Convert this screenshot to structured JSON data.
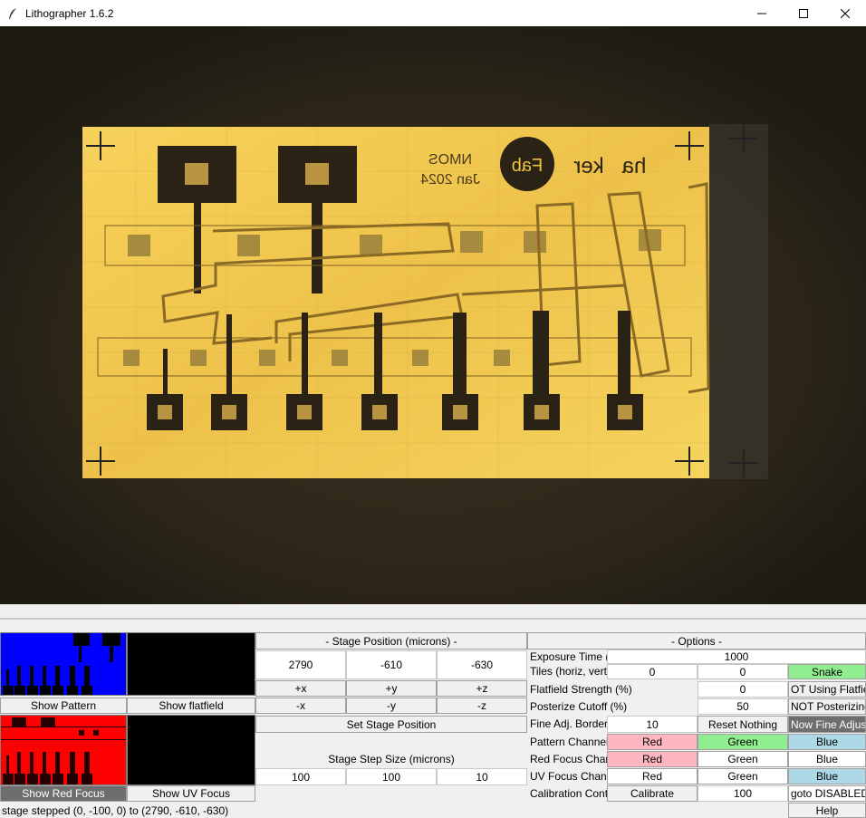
{
  "window": {
    "title": "Lithographer 1.6.2",
    "minimize_glyph": "—",
    "maximize_glyph": "☐",
    "close_glyph": "✕"
  },
  "camera": {
    "chip_text_top": "NMOS",
    "chip_text_date": "Jan 2024",
    "logo_text_left": "ha",
    "logo_text_mid": "ker",
    "logo_text_circle": "Fab"
  },
  "preview": {
    "show_pattern": "Show Pattern",
    "show_flatfield": "Show flatfield",
    "show_red_focus": "Show Red Focus",
    "show_uv_focus": "Show UV Focus"
  },
  "stage": {
    "header": "- Stage Position (microns) -",
    "x": "2790",
    "y": "-610",
    "z": "-630",
    "plus_x": "+x",
    "plus_y": "+y",
    "plus_z": "+z",
    "minus_x": "-x",
    "minus_y": "-y",
    "minus_z": "-z",
    "set_position": "Set Stage Position",
    "step_label": "Stage Step Size (microns)",
    "step_x": "100",
    "step_y": "100",
    "step_z": "10"
  },
  "options": {
    "header": "- Options -",
    "exposure_label": "Exposure Time (",
    "exposure_value": "1000",
    "tiles_label": "Tiles (horiz, vert)",
    "tiles_h": "0",
    "tiles_v": "0",
    "snake": "Snake",
    "flatfield_label": "Flatfield Strength (%)",
    "flatfield_value": "0",
    "flatfield_toggle": "OT Using Flatfie",
    "posterize_label": "Posterize Cutoff (%)",
    "posterize_value": "50",
    "posterize_toggle": "NOT Posterizing",
    "fine_label": "Fine Adj. Border",
    "fine_value": "10",
    "reset": "Reset Nothing",
    "fine_toggle": "Now Fine Adjust",
    "pattern_label": "Pattern Channel",
    "red_focus_label": "Red Focus Chan",
    "uv_focus_label": "UV Focus Chann",
    "red": "Red",
    "green": "Green",
    "blue": "Blue",
    "calib_label": "Calibration Cont",
    "calibrate": "Calibrate",
    "calib_value": "100",
    "goto": "goto DISABLED",
    "help": "Help"
  },
  "status": "stage stepped (0, -100, 0) to (2790, -610, -630)",
  "colors": {
    "pattern_preview_bg": "#0000ff",
    "red_preview_bg": "#ff0000",
    "pink": "#ffb6c1",
    "light_green": "#90ee90",
    "light_blue": "#add8e6",
    "chip_yellow": "#f0c23c"
  }
}
